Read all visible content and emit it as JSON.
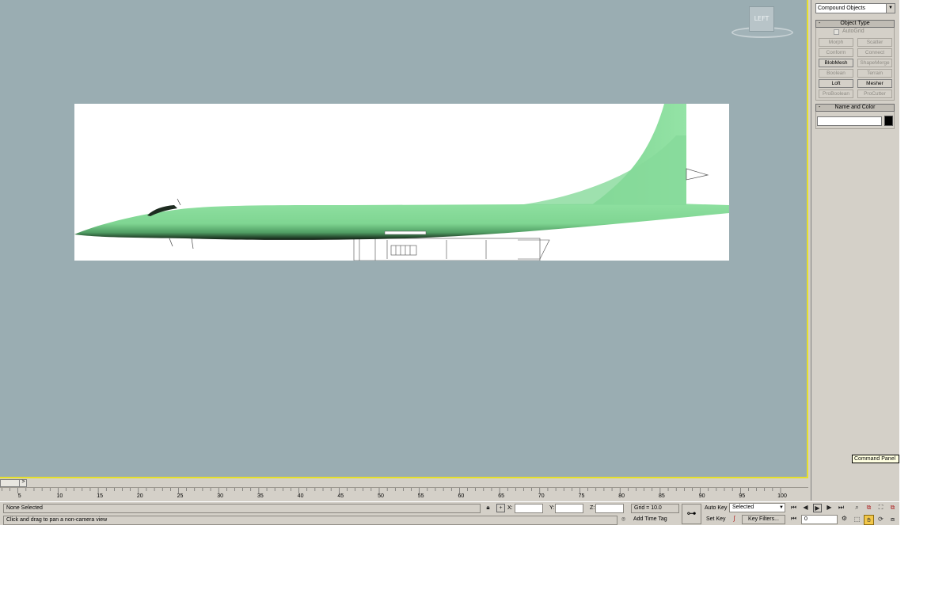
{
  "viewport": {
    "label": "LEFT",
    "accent": "#e6e02a",
    "background": "#9aadb2",
    "model_color": "#8ad99a"
  },
  "command_panel": {
    "category": "Compound Objects",
    "object_type": {
      "title": "Object Type",
      "collapse": "-",
      "autogrid": "AutoGrid",
      "buttons": [
        "Morph",
        "Scatter",
        "Conform",
        "Connect",
        "BlobMesh",
        "ShapeMerge",
        "Boolean",
        "Terrain",
        "Loft",
        "Mesher",
        "ProBoolean",
        "ProCutter"
      ],
      "enabled": [
        "BlobMesh",
        "Loft",
        "Mesher"
      ]
    },
    "name_color": {
      "title": "Name and Color",
      "collapse": "-",
      "name_value": "",
      "color": "#000000"
    },
    "tooltip": "Command Panel"
  },
  "timeline": {
    "next_arrow": ">",
    "ticks": [
      "5",
      "10",
      "15",
      "20",
      "25",
      "30",
      "35",
      "40",
      "45",
      "50",
      "55",
      "60",
      "65",
      "70",
      "75",
      "80",
      "85",
      "90",
      "95",
      "100"
    ]
  },
  "statusbar": {
    "selection": "None Selected",
    "prompt": "Click and drag to pan a non-camera view",
    "x_label": "X:",
    "y_label": "Y:",
    "z_label": "Z:",
    "x_value": "",
    "y_value": "",
    "z_value": "",
    "grid": "Grid = 10.0",
    "add_time_tag": "Add Time Tag",
    "auto_key": "Auto Key",
    "set_key": "Set Key",
    "key_mode": "Selected",
    "key_filters": "Key Filters...",
    "frame": "0"
  },
  "icons": {
    "lock": "lock-icon",
    "absolute_mode": "transform-mode-icon",
    "time_tag": "time-tag-icon",
    "key": "key-icon",
    "key_curve": "key-curve-icon",
    "goto_start": "goto-start-icon",
    "prev_frame": "prev-frame-icon",
    "play": "play-icon",
    "next_frame": "next-frame-icon",
    "goto_end": "goto-end-icon",
    "key_mode_toggle": "key-mode-icon",
    "time_config": "time-config-icon",
    "zoom": "zoom-icon",
    "zoom_all": "zoom-all-icon",
    "zoom_extents": "zoom-extents-icon",
    "zoom_extents_all": "zoom-extents-all-icon",
    "zoom_region": "zoom-region-icon",
    "pan": "pan-icon",
    "orbit": "orbit-icon",
    "maximize": "maximize-viewport-icon"
  }
}
